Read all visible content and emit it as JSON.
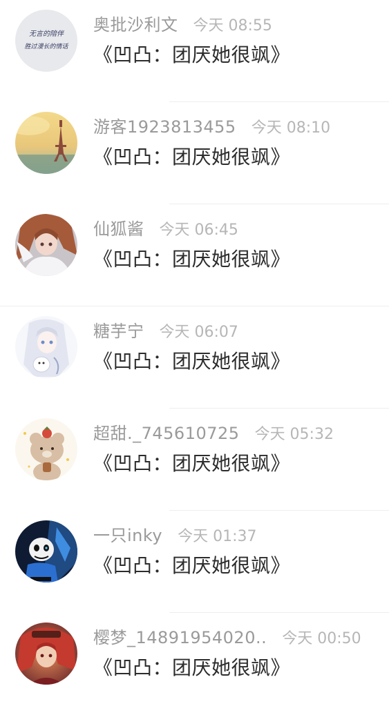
{
  "items": [
    {
      "name": "奥批沙利文",
      "time": "今天 08:55",
      "title": "《凹凸：团厌她很飒》",
      "avatar": "handwritten-note-avatar",
      "avatar_text_1": "无言的陪伴",
      "avatar_text_2": "胜过漫长的情话"
    },
    {
      "name": "游客1923813455",
      "time": "今天 08:10",
      "title": "《凹凸：团厌她很飒》",
      "avatar": "eiffel-tower-avatar"
    },
    {
      "name": "仙狐酱",
      "time": "今天 06:45",
      "title": "《凹凸：团厌她很飒》",
      "avatar": "anime-girl-avatar"
    },
    {
      "name": "糖芋宁",
      "time": "今天 06:07",
      "title": "《凹凸：团厌她很飒》",
      "avatar": "white-hair-girl-avatar"
    },
    {
      "name": "超甜._745610725",
      "time": "今天 05:32",
      "title": "《凹凸：团厌她很飒》",
      "avatar": "teddy-bear-avatar"
    },
    {
      "name": "一只inky",
      "time": "今天 01:37",
      "title": "《凹凸：团厌她很飒》",
      "avatar": "skeleton-character-avatar"
    },
    {
      "name": "樱梦_14891954020..",
      "time": "今天 00:50",
      "title": "《凹凸：团厌她很飒》",
      "avatar": "red-hair-character-avatar"
    }
  ],
  "colors": {
    "name": "#9a9a9a",
    "time": "#b6b6b6",
    "title": "#2c2c2c",
    "divider": "#eeeeee"
  }
}
